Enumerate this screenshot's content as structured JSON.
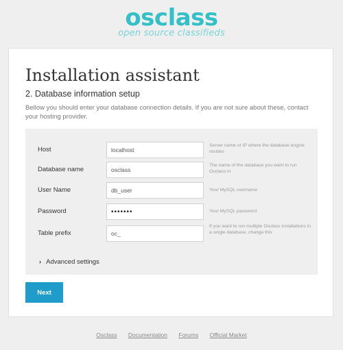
{
  "logo": {
    "main": "osclass",
    "tagline": "open source classifieds"
  },
  "page": {
    "title": "Installation assistant",
    "subtitle": "2. Database information setup",
    "description": "Bellow you should enter your database connection details. If you are not sure about these, contact your hosting provider."
  },
  "form": {
    "host": {
      "label": "Host",
      "value": "localhost",
      "help": "Server name or IP where the database engine resides"
    },
    "dbname": {
      "label": "Database name",
      "value": "osclass",
      "help": "The name of the database you want to run Osclass in"
    },
    "user": {
      "label": "User Name",
      "value": "db_user",
      "help": "Your MySQL username"
    },
    "password": {
      "label": "Password",
      "value": "•••••••",
      "help": "Your MySQL password"
    },
    "prefix": {
      "label": "Table prefix",
      "value": "oc_",
      "help": "If you want to run multiple Osclass installations in a single database, change this"
    },
    "advanced": {
      "icon": "chevron-right-icon",
      "label": "Advanced settings"
    }
  },
  "actions": {
    "next_label": "Next"
  },
  "footer": {
    "links": [
      "Osclass",
      "Documentation",
      "Forums",
      "Official Market"
    ]
  },
  "colors": {
    "brand": "#34c0c7",
    "button": "#1f9cca",
    "panel": "#efefef"
  }
}
